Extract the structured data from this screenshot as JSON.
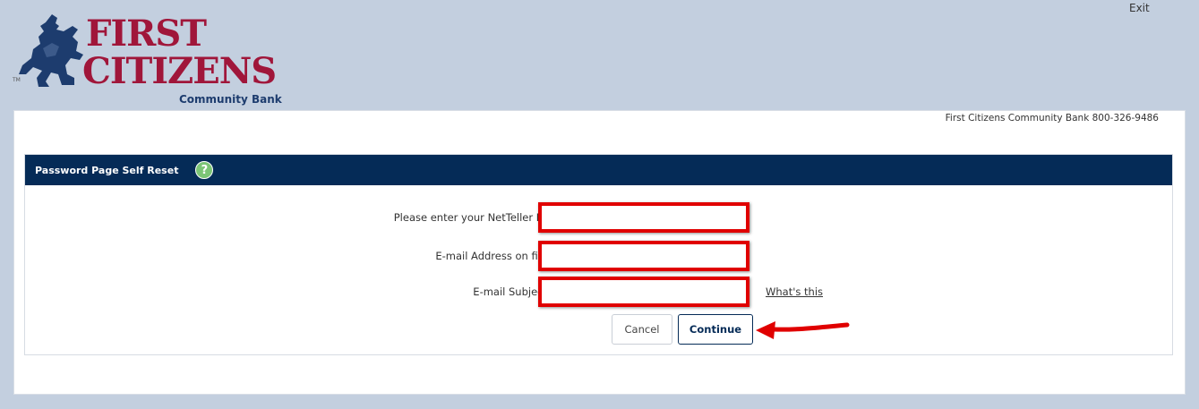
{
  "header": {
    "exit_label": "Exit",
    "logo": {
      "line1": "FIRST",
      "line2": "CITIZENS",
      "subtitle": "Community Bank",
      "tm": "TM"
    }
  },
  "contact": {
    "text": "First Citizens Community Bank 800-326-9486"
  },
  "form": {
    "title": "Password Page Self Reset",
    "help_icon": "?",
    "fields": [
      {
        "label": "Please enter your NetTeller ID",
        "value": ""
      },
      {
        "label": "E-mail Address on file",
        "value": ""
      },
      {
        "label": "E-mail Subject",
        "value": ""
      }
    ],
    "whats_this_label": "What's this",
    "cancel_label": "Cancel",
    "continue_label": "Continue"
  },
  "colors": {
    "header_bg": "#052b57",
    "highlight": "#e00000",
    "brand_red": "#a0163a",
    "brand_blue": "#1d3c6e",
    "page_bg": "#c3cfdf"
  },
  "icons": [
    "horseman-logo-icon",
    "help-question-icon",
    "red-arrow-annotation"
  ]
}
